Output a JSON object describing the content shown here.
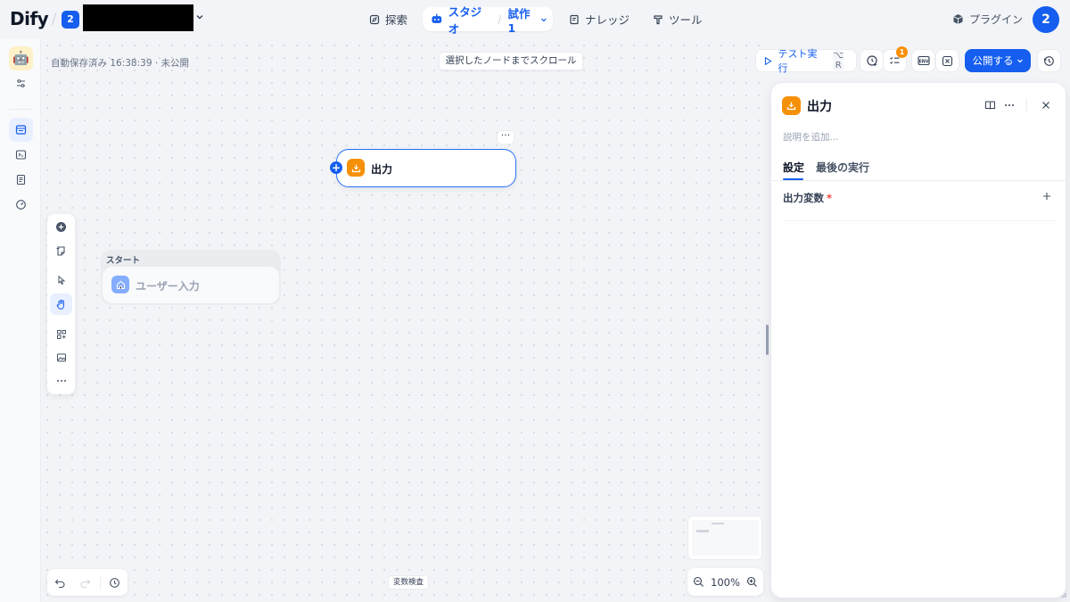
{
  "header": {
    "logo": "Dify",
    "workspace_badge": "2",
    "nav": {
      "explore": "探索",
      "studio": "スタジオ",
      "current_app": "試作1",
      "knowledge": "ナレッジ",
      "tools": "ツール"
    },
    "plugin": "プラグイン",
    "avatar": "2"
  },
  "canvas": {
    "autosave": "自動保存済み 16:38:39 · 未公開",
    "scroll_to_selected": "選択したノードまでスクロール",
    "output_node_title": "出力",
    "start_group_label": "スタート",
    "start_node_title": "ユーザー入力",
    "variable_inspect": "変数検査",
    "zoom_level": "100%"
  },
  "actions": {
    "test_run": "テスト実行",
    "test_run_shortcut_1": "⌥",
    "test_run_shortcut_2": "R",
    "checklist_badge": "1",
    "env_label": "ENV",
    "publish": "公開する"
  },
  "panel": {
    "title": "出力",
    "description_placeholder": "説明を追加...",
    "tabs": [
      "設定",
      "最後の実行"
    ],
    "output_vars_label": "出力変数",
    "required_mark": "*"
  },
  "colors": {
    "accent": "#155eef",
    "node_output": "#f79009",
    "node_start": "#84adff"
  }
}
